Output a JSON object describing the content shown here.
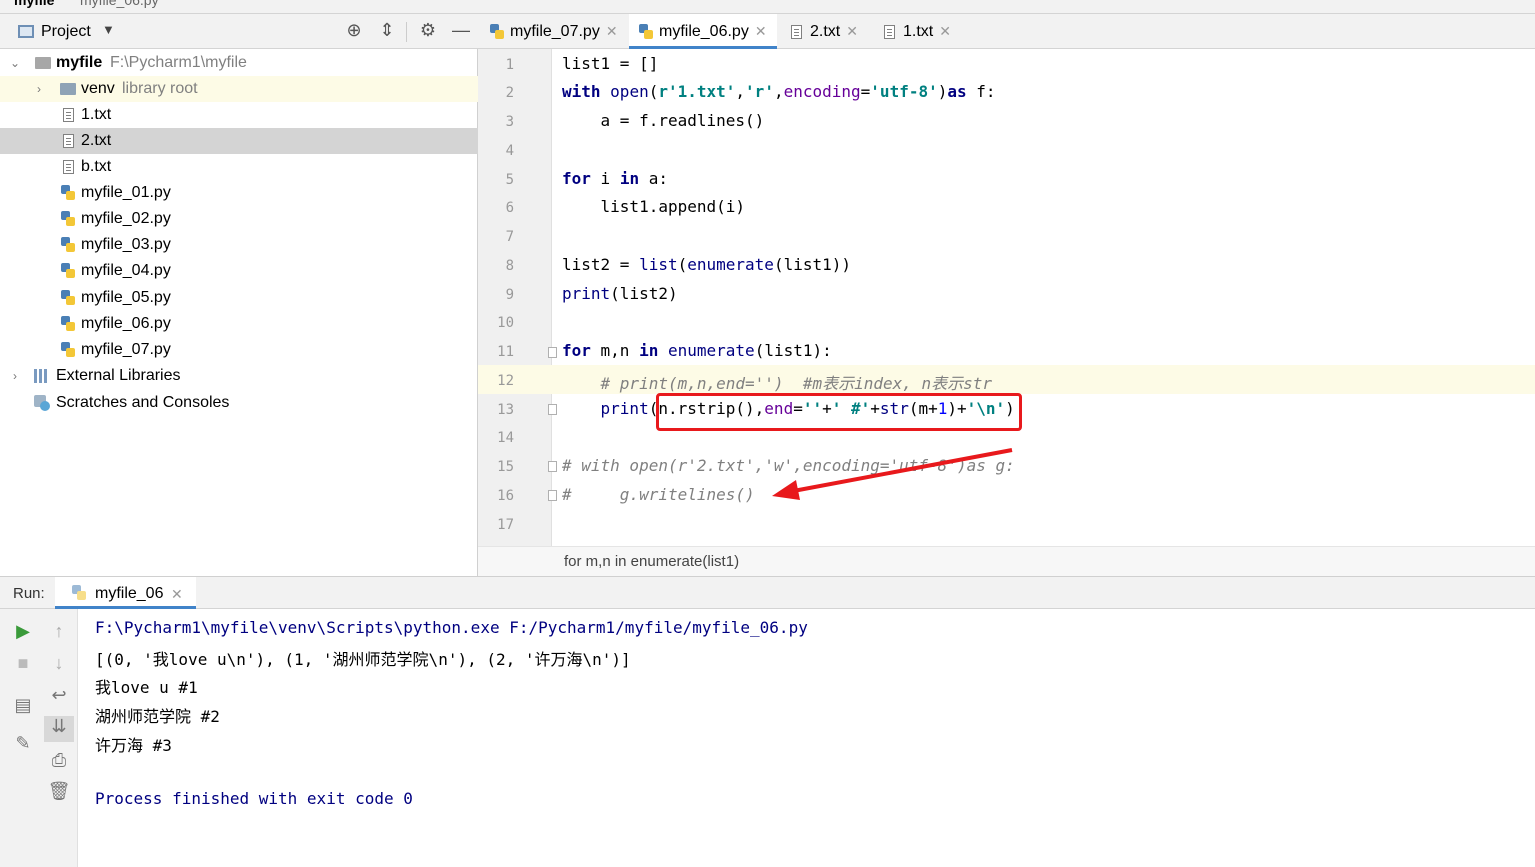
{
  "breadcrumb": {
    "project": "myfile",
    "file": "myfile_06.py"
  },
  "project_panel": {
    "title": "Project",
    "root": {
      "name": "myfile",
      "path": "F:\\Pycharm1\\myfile"
    },
    "venv": {
      "name": "venv",
      "hint": "library root"
    },
    "files": [
      "1.txt",
      "2.txt",
      "b.txt",
      "myfile_01.py",
      "myfile_02.py",
      "myfile_03.py",
      "myfile_04.py",
      "myfile_05.py",
      "myfile_06.py",
      "myfile_07.py"
    ],
    "external": "External Libraries",
    "scratches": "Scratches and Consoles",
    "selected_file": "2.txt"
  },
  "tabs": [
    "myfile_07.py",
    "myfile_06.py",
    "2.txt",
    "1.txt"
  ],
  "active_tab": "myfile_06.py",
  "line_numbers": [
    "1",
    "2",
    "3",
    "4",
    "5",
    "6",
    "7",
    "8",
    "9",
    "10",
    "11",
    "12",
    "13",
    "14",
    "15",
    "16",
    "17"
  ],
  "breadcrumb_bottom": "for m,n in enumerate(list1)",
  "run": {
    "label": "Run:",
    "tab": "myfile_06",
    "output": [
      "F:\\Pycharm1\\myfile\\venv\\Scripts\\python.exe F:/Pycharm1/myfile/myfile_06.py",
      "[(0, '我love u\\n'), (1, '湖州师范学院\\n'), (2, '许万海\\n')]",
      "我love u #1",
      "湖州师范学院 #2",
      "许万海 #3",
      "",
      "Process finished with exit code 0"
    ]
  },
  "colors": {
    "keyword": "#000080",
    "string": "#008080",
    "comment": "#808080",
    "kwarg": "#660099",
    "annotation": "#e8191c",
    "tab_accent": "#4083c9"
  },
  "icons": [
    "project-icon",
    "locate-icon",
    "collapse-icon",
    "gear-icon",
    "minimize-icon",
    "run-icon",
    "stop-icon",
    "rerun-up-icon",
    "rerun-down-icon",
    "wrap-icon",
    "scroll-end-icon",
    "print-icon",
    "trash-icon",
    "layout-icon",
    "pin-icon"
  ]
}
